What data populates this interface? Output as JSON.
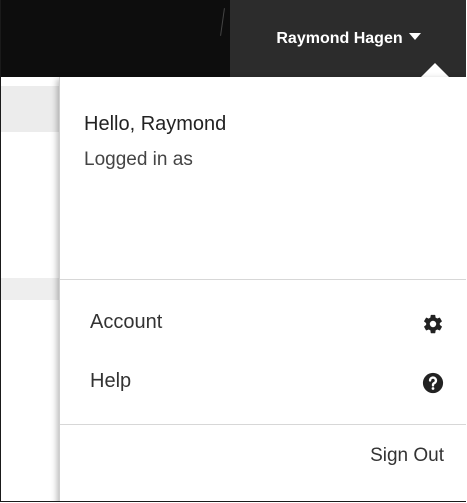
{
  "header": {
    "user_name": "Raymond Hagen",
    "caret_icon": "caret-down-icon"
  },
  "dropdown": {
    "greeting": "Hello, Raymond",
    "logged_in_label": "Logged in as",
    "items": [
      {
        "label": "Account",
        "icon": "gear-icon"
      },
      {
        "label": "Help",
        "icon": "question-circle-icon"
      }
    ],
    "sign_out_label": "Sign Out"
  },
  "colors": {
    "topbar": "#0d0d0d",
    "trigger_bg": "#2c2c2c",
    "text": "#333333",
    "divider": "#d7d7d7"
  }
}
